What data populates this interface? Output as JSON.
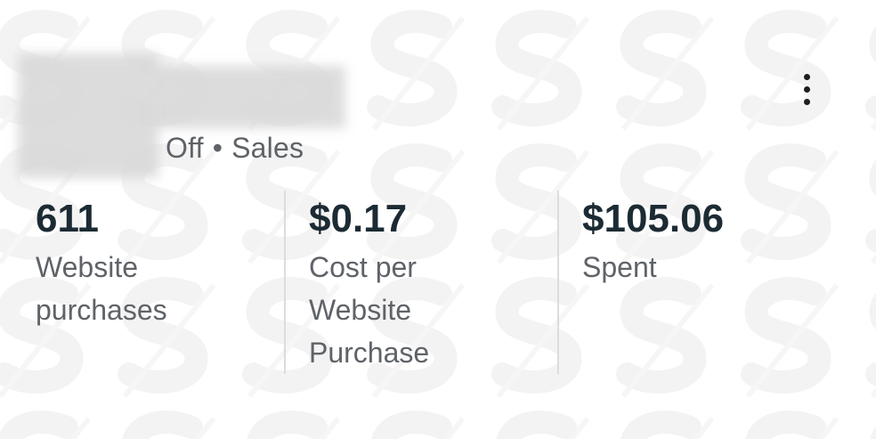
{
  "header": {
    "status": "Off",
    "separator": "•",
    "objective": "Sales",
    "more_icon": "more-vertical-icon"
  },
  "metrics": [
    {
      "value": "611",
      "label_lines": [
        "Website",
        "purchases"
      ]
    },
    {
      "value": "$0.17",
      "label_lines": [
        "Cost per",
        "Website",
        "Purchase"
      ]
    },
    {
      "value": "$105.06",
      "label_lines": [
        "Spent"
      ]
    }
  ],
  "colors": {
    "value_text": "#1c2b33",
    "label_text": "#5f6368",
    "divider": "#dcdcdc"
  }
}
